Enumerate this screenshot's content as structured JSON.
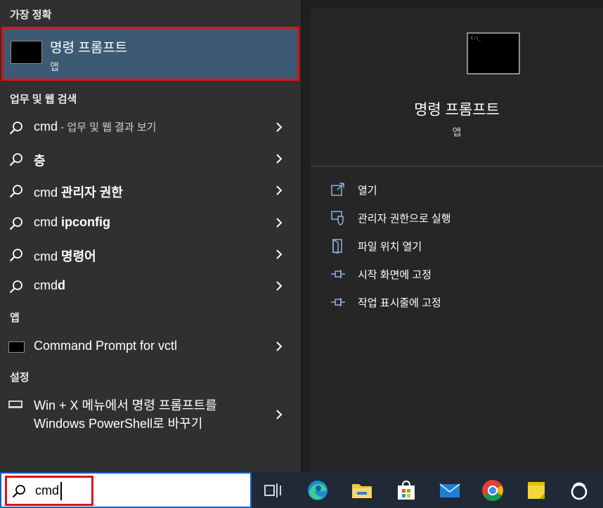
{
  "left": {
    "best_match_heading": "가장 정확",
    "best_match": {
      "title": "명령 프롬프트",
      "subtitle": "앱"
    },
    "web_heading": "업무 및 웹 검색",
    "web_results": [
      {
        "prefix": "cmd",
        "suffix": " - 업무 및 웹 결과 보기",
        "icon": "search-icon"
      },
      {
        "prefix": "",
        "suffix": "층",
        "icon": "search-icon"
      },
      {
        "prefix": "cmd ",
        "suffix": "관리자 권한",
        "icon": "search-icon"
      },
      {
        "prefix": "cmd ",
        "suffix": "ipconfig",
        "icon": "search-icon"
      },
      {
        "prefix": "cmd ",
        "suffix": "명령어",
        "icon": "search-icon"
      },
      {
        "prefix": "cmd",
        "suffix": "d",
        "icon": "search-icon"
      }
    ],
    "apps_heading": "앱",
    "apps": [
      {
        "label": "Command Prompt for vctl",
        "icon": "terminal-icon"
      }
    ],
    "settings_heading": "설정",
    "settings": [
      {
        "line1": "Win + X 메뉴에서 명령 프롬프트를",
        "line2": "Windows PowerShell로 바꾸기",
        "icon": "monitor-icon"
      }
    ]
  },
  "right": {
    "app_title": "명령 프롬프트",
    "app_subtitle": "앱",
    "actions": [
      {
        "label": "열기",
        "icon": "open-icon"
      },
      {
        "label": "관리자 권한으로 실행",
        "icon": "shield-icon"
      },
      {
        "label": "파일 위치 열기",
        "icon": "folder-icon"
      },
      {
        "label": "시작 화면에 고정",
        "icon": "pin-icon"
      },
      {
        "label": "작업 표시줄에 고정",
        "icon": "pin-icon"
      }
    ]
  },
  "taskbar": {
    "search_value": "cmd",
    "apps": [
      "task-view-icon",
      "edge-icon",
      "file-explorer-icon",
      "store-icon",
      "mail-icon",
      "chrome-icon",
      "sticky-notes-icon",
      "app-icon"
    ]
  },
  "colors": {
    "selected": "#3d5a75",
    "highlight_border": "#e01010",
    "accent": "#8ab4e0",
    "panel": "#303030"
  }
}
